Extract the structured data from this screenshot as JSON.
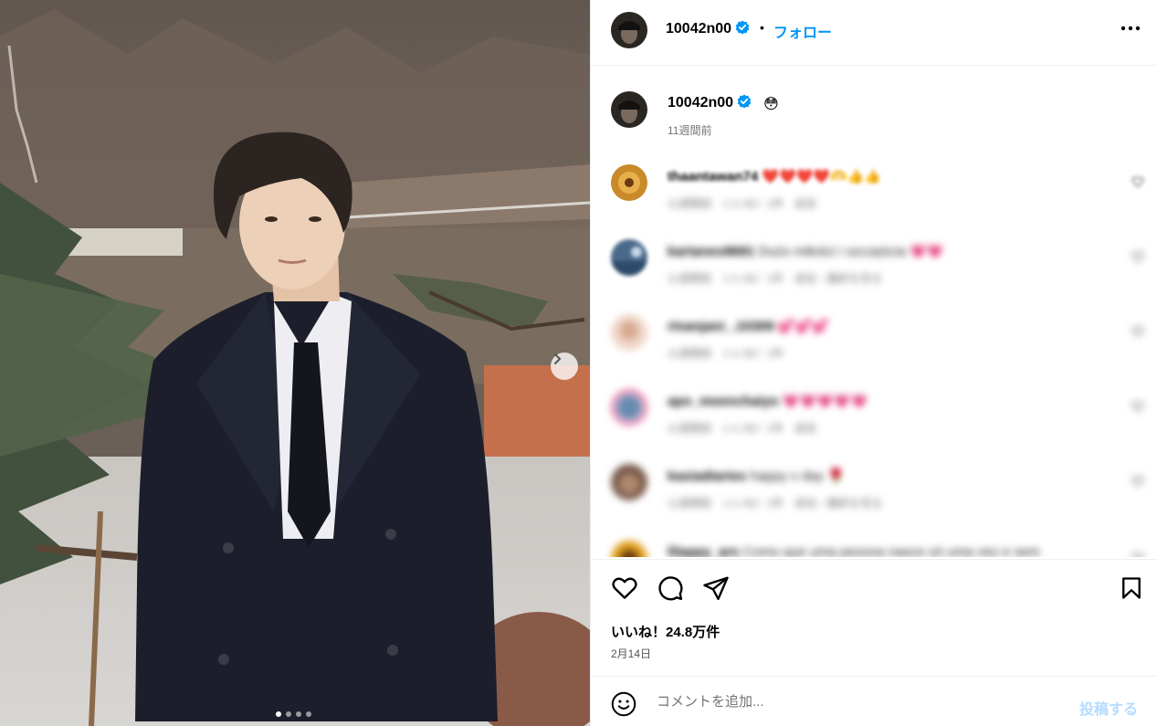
{
  "post": {
    "username": "10042n00",
    "follow_label": "フォロー",
    "separator": "•",
    "caption_emoji": "😳",
    "caption_time": "11週間前",
    "likes_label": "いいね！24.8万件",
    "date_label": "2月14日",
    "carousel_total": 4,
    "carousel_active": 1
  },
  "comments": [
    {
      "user": "thaantawan74",
      "text": "❤️❤️❤️❤️🫶👍👍",
      "meta": "11週間前　いいね！1件　返信"
    },
    {
      "user": "kartanes9681",
      "text": "Dużo miłości i szczęścia 💗💗",
      "meta": "11週間前　いいね！1件　返信・翻訳を見る"
    },
    {
      "user": "rinanjani_.10309",
      "text": "💕💕💕",
      "meta": "11週間前　いいね！1件"
    },
    {
      "user": "apo_meenchaiyo",
      "text": "💗💗💗💗💗",
      "meta": "11週間前　いいね！1件　返信"
    },
    {
      "user": "kasiadiaries",
      "text": "happy v day 🌹",
      "meta": "11週間前　いいね！1件　返信・翻訳を見る"
    },
    {
      "user": "lilappy_ars",
      "text": "Como que uma pessoa nasce só uma vez e sem",
      "meta": ""
    }
  ],
  "comment_box": {
    "placeholder": "コメントを追加...",
    "post_label": "投稿する"
  },
  "icons": {
    "verified": "verified-badge-icon",
    "more": "more-options-icon",
    "like": "heart-icon",
    "comment": "comment-bubble-icon",
    "share": "paper-plane-icon",
    "save": "bookmark-icon",
    "emoji": "smiley-icon",
    "next": "chevron-right-icon"
  },
  "colors": {
    "accent": "#0095f6",
    "post_disabled": "#b3dbff",
    "verified": "#0095f6"
  }
}
